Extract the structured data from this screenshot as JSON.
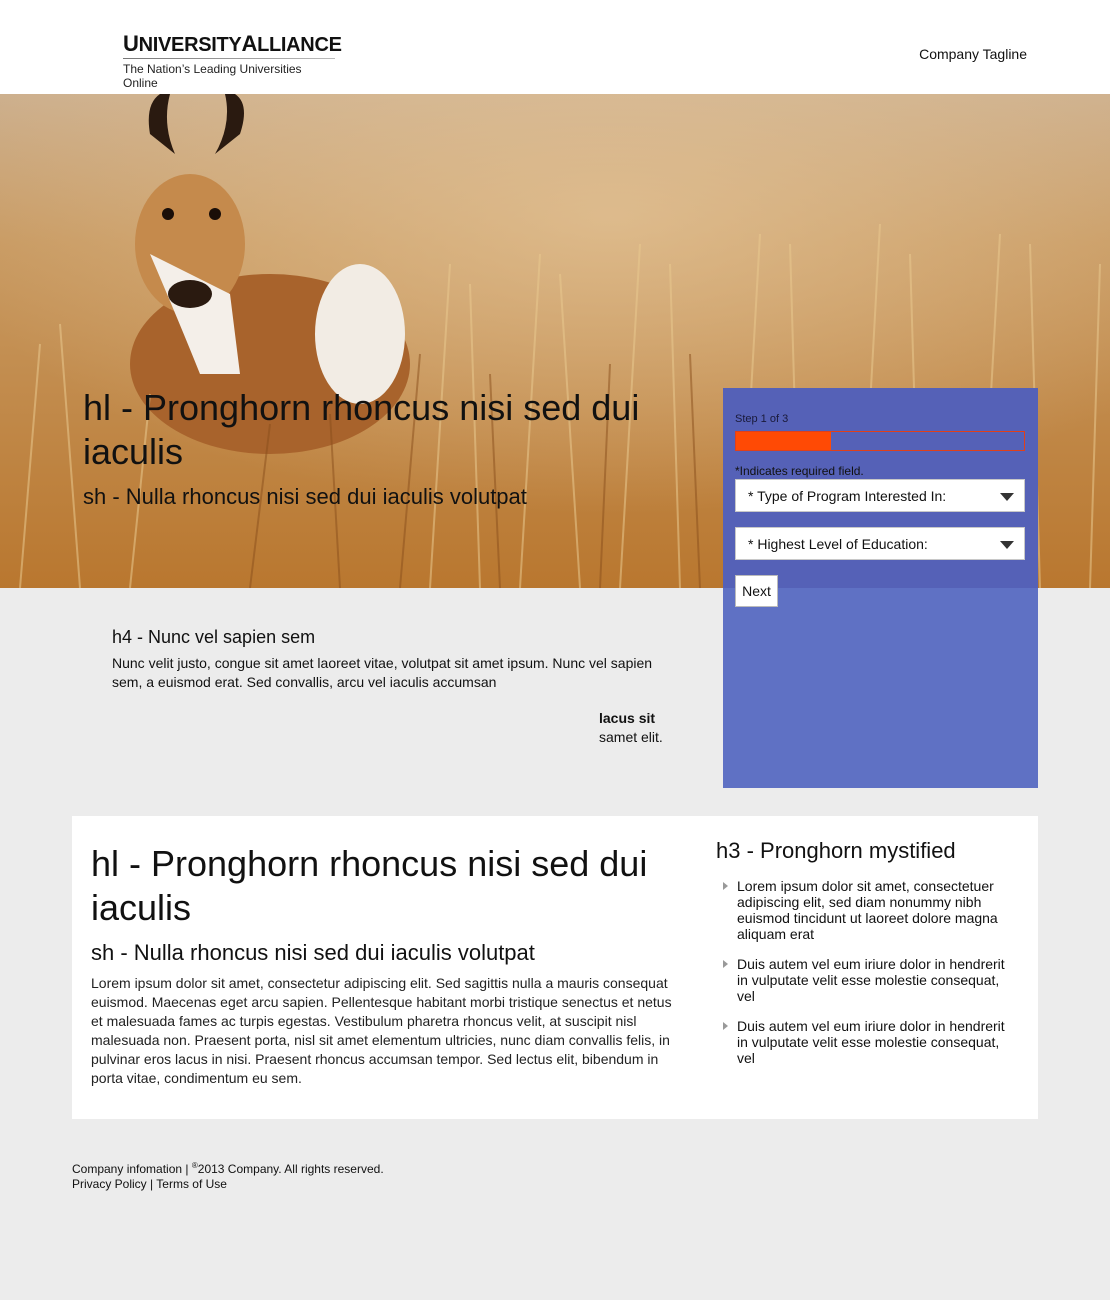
{
  "header": {
    "logo_name_part1": "UNIVERSITY",
    "logo_name_part2": "ALLIANCE",
    "logo_subtitle": "The Nation’s Leading Universities Online",
    "tagline": "Company Tagline"
  },
  "hero": {
    "title": "hl - Pronghorn rhoncus nisi sed dui iaculis",
    "subtitle": "sh - Nulla rhoncus nisi sed dui iaculis volutpat"
  },
  "form": {
    "step_label": "Step 1 of 3",
    "progress": 0.33,
    "required_note": "*Indicates required field.",
    "program_select": "* Type of Program Interested In:",
    "education_select": "* Highest Level of Education:",
    "next_label": "Next",
    "colors": {
      "panel": "#5f71c4",
      "progress": "#ff4a05"
    }
  },
  "mid": {
    "heading": "h4 - Nunc vel sapien sem",
    "body": "Nunc velit justo, congue sit amet laoreet vitae, volutpat sit amet ipsum. Nunc vel sapien sem, a euismod erat. Sed convallis, arcu vel iaculis accumsan",
    "quote_bold": "lacus sit",
    "quote_text": "samet elit."
  },
  "content": {
    "title": "hl - Pronghorn rhoncus nisi sed dui iaculis",
    "subtitle": "sh - Nulla rhoncus nisi sed dui iaculis volutpat",
    "body": "Lorem ipsum dolor sit amet, consectetur adipiscing elit. Sed sagittis nulla a mauris consequat euismod. Maecenas eget arcu sapien. Pellentesque habitant morbi tristique senectus et netus et malesuada fames ac turpis egestas. Vestibulum pharetra rhoncus velit, at suscipit nisl malesuada non. Praesent porta, nisl sit amet elementum ultricies, nunc diam convallis felis, in pulvinar eros lacus in nisi. Praesent rhoncus accumsan tempor. Sed lectus elit, bibendum in porta vitae, condimentum eu sem.",
    "side_heading": "h3 - Pronghorn mystified",
    "side_items": [
      "Lorem ipsum dolor sit amet, consectetuer adipiscing elit, sed diam nonummy nibh euismod tincidunt ut laoreet dolore magna aliquam erat",
      "Duis autem vel eum iriure dolor in hendrerit in vulputate velit esse molestie consequat, vel",
      "Duis autem vel eum iriure dolor in hendrerit in vulputate velit esse molestie consequat, vel"
    ]
  },
  "footer": {
    "company_info": "Company infomation",
    "separator": "|",
    "copyright_symbol": "®",
    "copyright_text": "2013 Company. All rights reserved.",
    "privacy": "Privacy Policy",
    "terms": "Terms of Use"
  }
}
